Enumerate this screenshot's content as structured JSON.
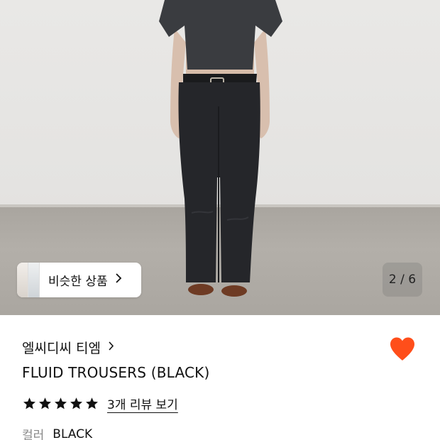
{
  "gallery": {
    "similar_label": "비슷한 상품",
    "similar_chevron": "›",
    "counter": "2 / 6",
    "image_alt": "model-wearing-black-trousers"
  },
  "product": {
    "brand": "엘씨디씨 티엠",
    "brand_chevron": "›",
    "title": "FLUID TROUSERS (BLACK)",
    "rating": 5,
    "review_link": "3개 리뷰 보기",
    "color_label": "컬러",
    "color_value": "BLACK",
    "wishlisted": true
  },
  "colors": {
    "accent": "#ff4e1a",
    "text": "#111111",
    "muted": "#888888"
  },
  "icons": {
    "heart": "heart-icon",
    "star": "star-icon",
    "chevron": "chevron-right-icon"
  }
}
